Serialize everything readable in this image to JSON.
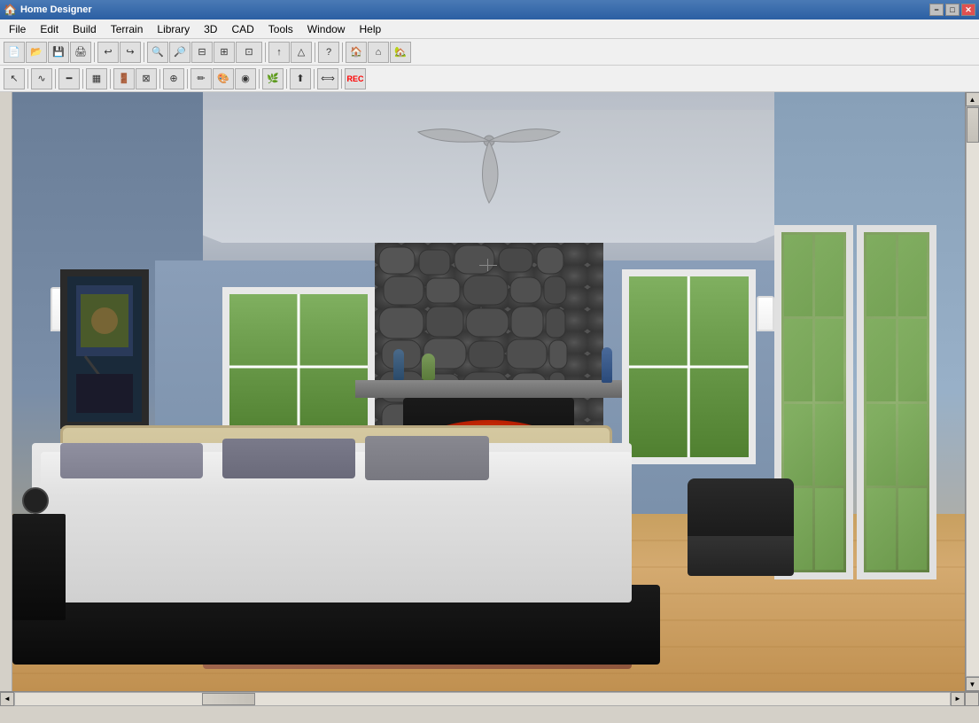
{
  "titleBar": {
    "title": "Home Designer",
    "icon": "🏠",
    "minimizeLabel": "−",
    "maximizeLabel": "□",
    "closeLabel": "✕"
  },
  "menuBar": {
    "items": [
      {
        "id": "file",
        "label": "File"
      },
      {
        "id": "edit",
        "label": "Edit"
      },
      {
        "id": "build",
        "label": "Build"
      },
      {
        "id": "terrain",
        "label": "Terrain"
      },
      {
        "id": "library",
        "label": "Library"
      },
      {
        "id": "3d",
        "label": "3D"
      },
      {
        "id": "cad",
        "label": "CAD"
      },
      {
        "id": "tools",
        "label": "Tools"
      },
      {
        "id": "window",
        "label": "Window"
      },
      {
        "id": "help",
        "label": "Help"
      }
    ]
  },
  "toolbar1": {
    "buttons": [
      {
        "id": "new",
        "label": "📄"
      },
      {
        "id": "open",
        "label": "📂"
      },
      {
        "id": "save",
        "label": "💾"
      },
      {
        "id": "print",
        "label": "🖨"
      },
      {
        "id": "undo",
        "label": "↩"
      },
      {
        "id": "redo",
        "label": "↪"
      },
      {
        "id": "zoom-out",
        "label": "🔍"
      },
      {
        "id": "zoom-in",
        "label": "🔎"
      },
      {
        "id": "zoom-fit",
        "label": "⊡"
      },
      {
        "id": "zoom-rect",
        "label": "⊞"
      },
      {
        "id": "pan",
        "label": "✋"
      },
      {
        "id": "select",
        "label": "⤢"
      },
      {
        "id": "arrow",
        "label": "↑"
      },
      {
        "id": "help",
        "label": "?"
      },
      {
        "id": "house",
        "label": "🏠"
      },
      {
        "id": "roof",
        "label": "⌂"
      },
      {
        "id": "home2",
        "label": "🏡"
      }
    ]
  },
  "statusBar": {
    "text": ""
  }
}
